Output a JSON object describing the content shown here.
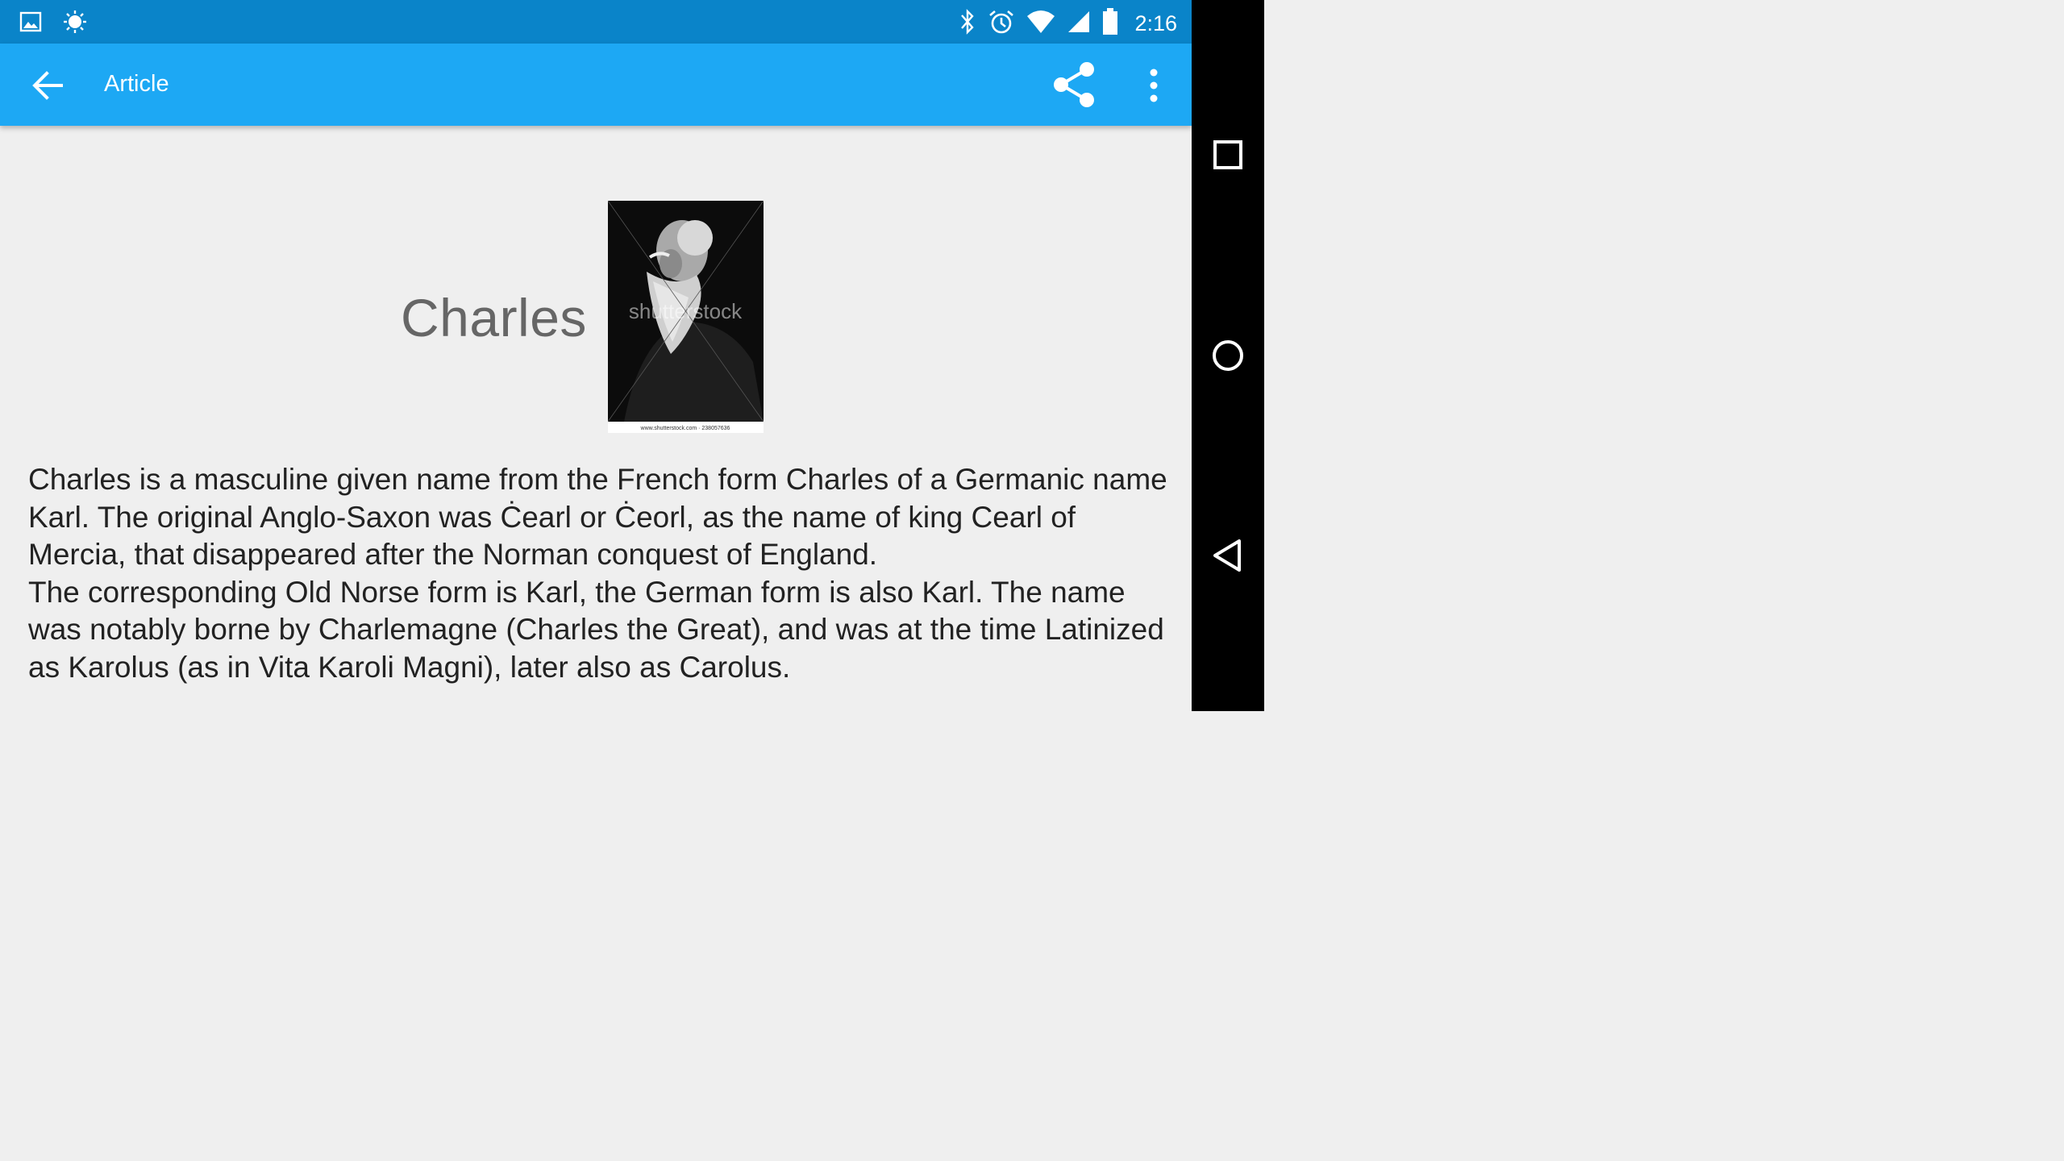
{
  "status_bar": {
    "time": "2:16",
    "left_icons": [
      "image-notification-icon",
      "brightness-icon"
    ],
    "right_icons": [
      "bluetooth-icon",
      "alarm-icon",
      "wifi-icon",
      "cell-signal-icon",
      "battery-icon"
    ]
  },
  "app_bar": {
    "title": "Article",
    "back_icon": "arrow-back-icon",
    "share_icon": "share-icon",
    "more_icon": "more-vert-icon",
    "color": "#1da8f4"
  },
  "article": {
    "heading": "Charles",
    "image": {
      "watermark": "shutterstock",
      "caption": "www.shutterstock.com · 238057636"
    },
    "paragraphs": [
      "Charles is a masculine given name from the French form Charles of a Germanic name Karl. The original Anglo-Saxon was Ċearl or Ċeorl, as the name of king Cearl of Mercia, that disappeared after the Norman conquest of England.",
      "The corresponding Old Norse form is Karl, the German form is also Karl. The name was notably borne by Charlemagne (Charles the Great), and was at the time Latinized as Karolus (as in Vita Karoli Magni), later also as Carolus."
    ]
  },
  "nav_bar": {
    "buttons": [
      "recents-square-icon",
      "home-circle-icon",
      "back-triangle-icon"
    ]
  }
}
